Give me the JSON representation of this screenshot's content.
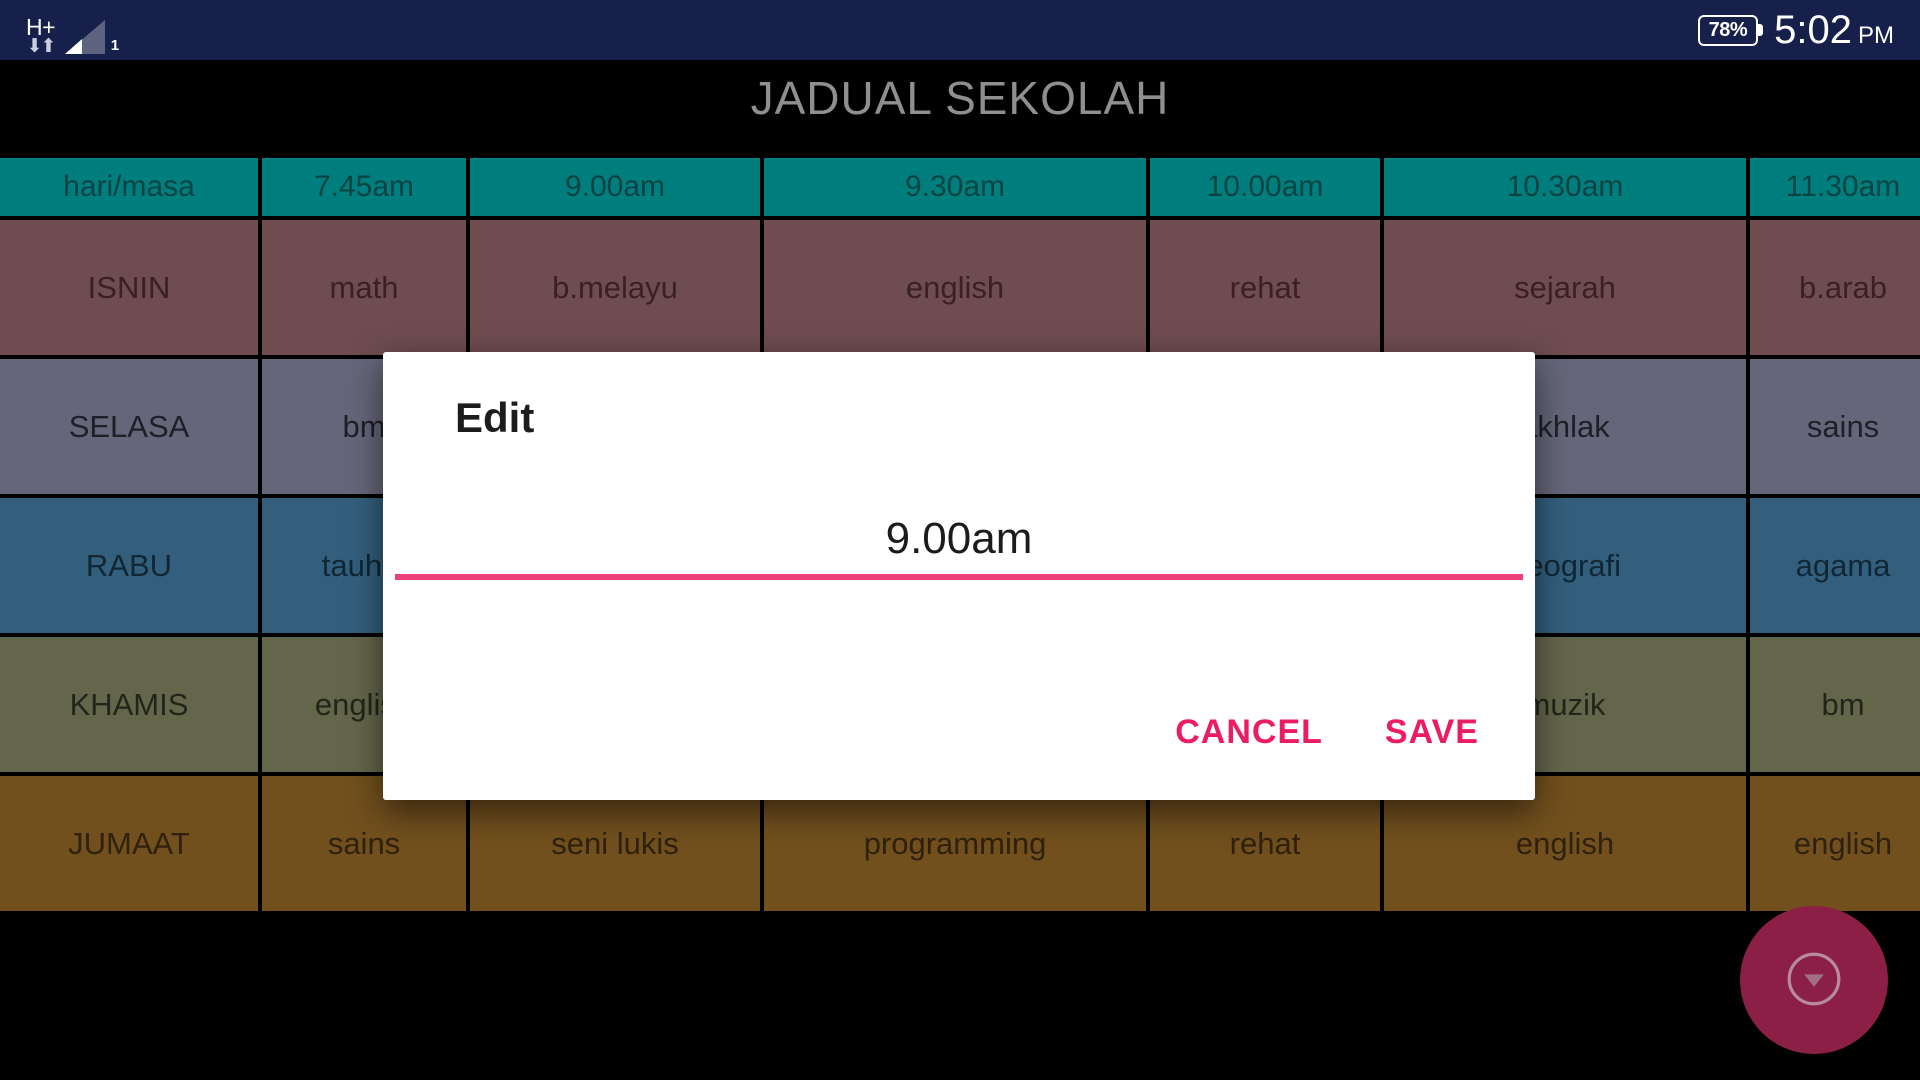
{
  "status_bar": {
    "network_label": "H+",
    "data_arrows": "⇅",
    "signal_sim": "1",
    "battery_percent": "78%",
    "time": "5:02",
    "am_pm": "PM",
    "background_color": "#16204a"
  },
  "page_title": "JADUAL SEKOLAH",
  "timetable": {
    "header_bg": "#007e7e",
    "header_text_color": "#0b4343",
    "columns": [
      "hari/masa",
      "7.45am",
      "9.00am",
      "9.30am",
      "10.00am",
      "10.30am",
      "11.30am"
    ],
    "rows": [
      {
        "day": "ISNIN",
        "bg": "#6e4c50",
        "text_color": "#3b2023",
        "cells": [
          "math",
          "b.melayu",
          "english",
          "rehat",
          "sejarah",
          "b.arab"
        ]
      },
      {
        "day": "SELASA",
        "bg": "#66667a",
        "text_color": "#1f1f28",
        "cells": [
          "bm",
          "",
          "",
          "",
          "akhlak",
          "sains"
        ]
      },
      {
        "day": "RABU",
        "bg": "#335f7d",
        "text_color": "#102736",
        "cells": [
          "tauhid",
          "",
          "",
          "",
          "geografi",
          "agama"
        ]
      },
      {
        "day": "KHAMIS",
        "bg": "#64664b",
        "text_color": "#23251a",
        "cells": [
          "english",
          "",
          "",
          "",
          "muzik",
          "bm"
        ]
      },
      {
        "day": "JUMAAT",
        "bg": "#72501e",
        "text_color": "#30210c",
        "cells": [
          "sains",
          "seni lukis",
          "programming",
          "rehat",
          "english",
          "english"
        ]
      }
    ]
  },
  "edit_dialog": {
    "title": "Edit",
    "input_value": "9.00am",
    "input_placeholder": "",
    "cancel_label": "CANCEL",
    "save_label": "SAVE",
    "accent_color": "#ec1c62",
    "underline_color": "#ec407a"
  },
  "fab": {
    "icon": "arrow-drop-down-circle-icon",
    "color": "#8c1f45"
  }
}
